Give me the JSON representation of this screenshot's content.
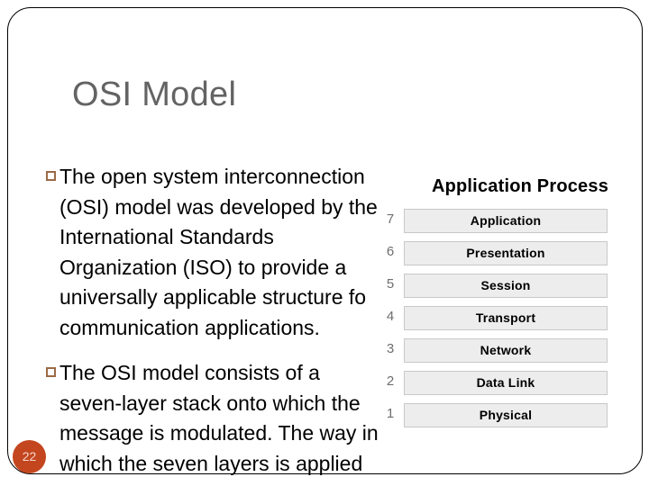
{
  "slide": {
    "title": "OSI Model",
    "number": "22",
    "bullets": [
      {
        "marker": "hollow-square",
        "text": "The open system interconnection (OSI) model was developed by the International Standards Organization (ISO) to provide a universally applicable structure fo communication applications."
      },
      {
        "marker": "hollow-square",
        "text": "The OSI model consists of a seven-layer stack onto which the message is modulated. The way in which the seven layers is applied"
      }
    ]
  },
  "diagram": {
    "heading": "Application Process",
    "layers": [
      {
        "number": "7",
        "name": "Application"
      },
      {
        "number": "6",
        "name": "Presentation"
      },
      {
        "number": "5",
        "name": "Session"
      },
      {
        "number": "4",
        "name": "Transport"
      },
      {
        "number": "3",
        "name": "Network"
      },
      {
        "number": "2",
        "name": "Data Link"
      },
      {
        "number": "1",
        "name": "Physical"
      }
    ]
  },
  "colors": {
    "title": "#636363",
    "bullet_marker": "#9b6a45",
    "badge": "#c4461f",
    "layer_box_fill": "#ededed",
    "layer_box_border": "#c8c8c8",
    "frame_border": "#000000",
    "background": "#ffffff"
  }
}
